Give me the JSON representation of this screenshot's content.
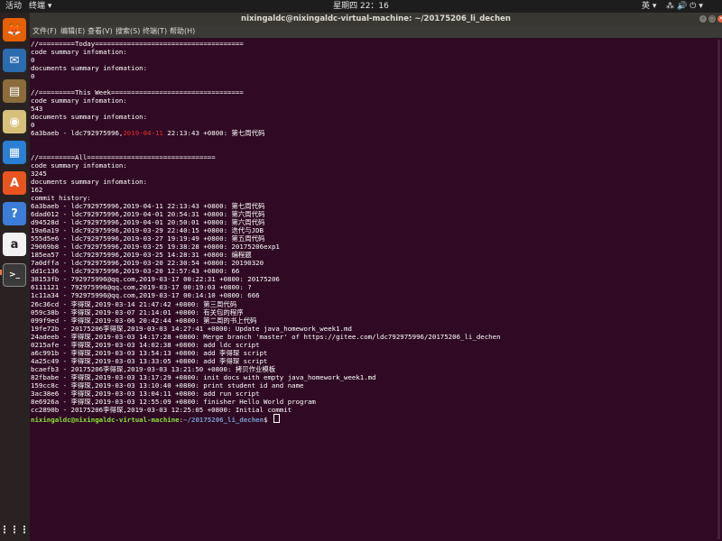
{
  "topbar": {
    "activities": "活动",
    "app_menu": "终端 ▾",
    "clock": "星期四 22：16",
    "lang": "英 ▾",
    "sys_icons": "⁂🔊⏻▾"
  },
  "dock": {
    "items": [
      {
        "name": "firefox",
        "glyph": "🦊",
        "color": "#e66000"
      },
      {
        "name": "thunderbird",
        "glyph": "✉",
        "color": "#2b6cb0"
      },
      {
        "name": "files",
        "glyph": "▤",
        "color": "#8a6d3b"
      },
      {
        "name": "rhythmbox",
        "glyph": "◉",
        "color": "#d7c17a"
      },
      {
        "name": "libreoffice-writer",
        "glyph": "▦",
        "color": "#2a7fd4"
      },
      {
        "name": "software-center",
        "glyph": "A",
        "color": "#e95420"
      },
      {
        "name": "help",
        "glyph": "?",
        "color": "#3b7dd8"
      },
      {
        "name": "amazon",
        "glyph": "a",
        "color": "#f2f2f2"
      },
      {
        "name": "terminal",
        "glyph": ">_",
        "color": "#3a3a3a"
      }
    ],
    "apps_grid": "⋮⋮⋮"
  },
  "window": {
    "title": "nixingaldc@nixingaldc-virtual-machine: ~/20175206_li_dechen",
    "minimize": "–",
    "maximize": "□",
    "close": "✕"
  },
  "menu": [
    "文件(F)",
    "编辑(E)",
    "查看(V)",
    "搜索(S)",
    "终端(T)",
    "帮助(H)"
  ],
  "terminal": {
    "lines_before_highlight": [
      "//=========Today=====================================",
      "code summary infomation:",
      "0",
      "documents summary infomation:",
      "0",
      "",
      "//=========This Week=================================",
      "code summary infomation:",
      "543",
      "documents summary infomation:",
      "0"
    ],
    "highlight_line": {
      "pre": "6a3baeb - ldc792975996,",
      "red": "2019-04-11",
      "post": " 22:13:43 +0800: 第七周代码"
    },
    "lines_after_highlight": [
      "",
      "",
      "//=========All================================",
      "code summary infomation:",
      "3245",
      "documents summary infomation:",
      "162",
      "commit history:",
      "6a3baeb - ldc792975996,2019-04-11 22:13:43 +0800: 第七周代码",
      "6dad012 - ldc792975996,2019-04-01 20:54:31 +0800: 第六周代码",
      "d94528d - ldc792975996,2019-04-01 20:50:01 +0800: 第六周代码",
      "19a6a19 - ldc792975996,2019-03-29 22:40:15 +0800: 迭代与JDB",
      "555d5e6 - ldc792975996,2019-03-27 19:19:49 +0800: 第五周代码",
      "29069b8 - ldc792975996,2019-03-25 19:38:28 +0800: 20175206exp1",
      "185ea57 - ldc792975996,2019-03-25 14:28:31 +0800: 编程题",
      "7a0dffa - ldc792975996,2019-03-20 22:30:54 +0800: 20190320",
      "dd1c136 - ldc792975996,2019-03-20 12:57:43 +0800: 66",
      "38153fb - 792975996@qq.com,2019-03-17 00:22:31 +0800: 20175206",
      "6111121 - 792975996@qq.com,2019-03-17 00:19:03 +0800: ?",
      "1c11a34 - 792975996@qq.com,2019-03-17 00:14:10 +0800: 666",
      "26c36cd - 李得琛,2019-03-14 21:47:42 +0800: 第三周代码",
      "059c38b - 李得琛,2019-03-07 21:14:01 +0800: 有关包的程序",
      "099f9ed - 李得琛,2019-03-06 20:42:44 +0800: 第二周的书上代码",
      "19fe72b - 20175206李得琛,2019-03-03 14:27:41 +0800: Update java_homework_week1.md",
      "24adeeb - 李得琛,2019-03-03 14:17:28 +0800: Merge branch 'master' of https://gitee.com/ldc792975996/20175206_li_dechen",
      "0215afe - 李得琛,2019-03-03 14:02:38 +0800: add ldc script",
      "a6c991b - 李得琛,2019-03-03 13:54:13 +0800: add 李得琛 script",
      "4a25c49 - 李得琛,2019-03-03 13:33:05 +0800: add 李得琛 script",
      "bcaefb3 - 20175206李得琛,2019-03-03 13:21:50 +0800: 拷贝作业模板",
      "82fbabe - 李得琛,2019-03-03 13:17:29 +0800: init docs with empty java_homework_week1.md",
      "159cc8c - 李得琛,2019-03-03 13:10:40 +0800: print student id and name",
      "3ac38e6 - 李得琛,2019-03-03 13:04:11 +0800: add run script",
      "8e6926a - 李得琛,2019-03-03 12:55:09 +0800: finisher Hello World program",
      "cc2890b - 20175206李得琛,2019-03-03 12:25:05 +0800: Initial commit"
    ],
    "prompt_user": "nixingaldc@nixingaldc-virtual-machine",
    "prompt_sep": ":",
    "prompt_path": "~/20175206_li_dechen",
    "prompt_symbol": "$ "
  }
}
